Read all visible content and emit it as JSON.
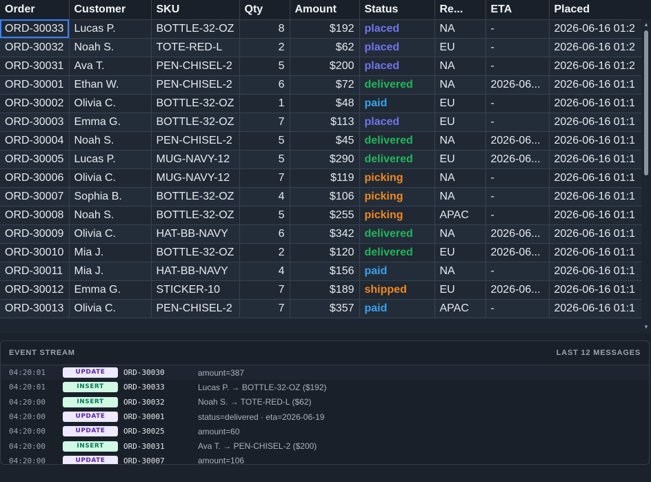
{
  "grid": {
    "columns": [
      "Order",
      "Customer",
      "SKU",
      "Qty",
      "Amount",
      "Status",
      "Re...",
      "ETA",
      "Placed"
    ],
    "rows": [
      {
        "order": "ORD-30033",
        "customer": "Lucas P.",
        "sku": "BOTTLE-32-OZ",
        "qty": "8",
        "amount": "$192",
        "status": "placed",
        "region": "NA",
        "eta": "-",
        "placed": "2026-06-16 01:2"
      },
      {
        "order": "ORD-30032",
        "customer": "Noah S.",
        "sku": "TOTE-RED-L",
        "qty": "2",
        "amount": "$62",
        "status": "placed",
        "region": "EU",
        "eta": "-",
        "placed": "2026-06-16 01:2"
      },
      {
        "order": "ORD-30031",
        "customer": "Ava T.",
        "sku": "PEN-CHISEL-2",
        "qty": "5",
        "amount": "$200",
        "status": "placed",
        "region": "NA",
        "eta": "-",
        "placed": "2026-06-16 01:2"
      },
      {
        "order": "ORD-30001",
        "customer": "Ethan W.",
        "sku": "PEN-CHISEL-2",
        "qty": "6",
        "amount": "$72",
        "status": "delivered",
        "region": "NA",
        "eta": "2026-06...",
        "placed": "2026-06-16 01:1"
      },
      {
        "order": "ORD-30002",
        "customer": "Olivia C.",
        "sku": "BOTTLE-32-OZ",
        "qty": "1",
        "amount": "$48",
        "status": "paid",
        "region": "EU",
        "eta": "-",
        "placed": "2026-06-16 01:1"
      },
      {
        "order": "ORD-30003",
        "customer": "Emma G.",
        "sku": "BOTTLE-32-OZ",
        "qty": "7",
        "amount": "$113",
        "status": "placed",
        "region": "EU",
        "eta": "-",
        "placed": "2026-06-16 01:1"
      },
      {
        "order": "ORD-30004",
        "customer": "Noah S.",
        "sku": "PEN-CHISEL-2",
        "qty": "5",
        "amount": "$45",
        "status": "delivered",
        "region": "NA",
        "eta": "2026-06...",
        "placed": "2026-06-16 01:1"
      },
      {
        "order": "ORD-30005",
        "customer": "Lucas P.",
        "sku": "MUG-NAVY-12",
        "qty": "5",
        "amount": "$290",
        "status": "delivered",
        "region": "EU",
        "eta": "2026-06...",
        "placed": "2026-06-16 01:1"
      },
      {
        "order": "ORD-30006",
        "customer": "Olivia C.",
        "sku": "MUG-NAVY-12",
        "qty": "7",
        "amount": "$119",
        "status": "picking",
        "region": "NA",
        "eta": "-",
        "placed": "2026-06-16 01:1"
      },
      {
        "order": "ORD-30007",
        "customer": "Sophia B.",
        "sku": "BOTTLE-32-OZ",
        "qty": "4",
        "amount": "$106",
        "status": "picking",
        "region": "NA",
        "eta": "-",
        "placed": "2026-06-16 01:1"
      },
      {
        "order": "ORD-30008",
        "customer": "Noah S.",
        "sku": "BOTTLE-32-OZ",
        "qty": "5",
        "amount": "$255",
        "status": "picking",
        "region": "APAC",
        "eta": "-",
        "placed": "2026-06-16 01:1"
      },
      {
        "order": "ORD-30009",
        "customer": "Olivia C.",
        "sku": "HAT-BB-NAVY",
        "qty": "6",
        "amount": "$342",
        "status": "delivered",
        "region": "NA",
        "eta": "2026-06...",
        "placed": "2026-06-16 01:1"
      },
      {
        "order": "ORD-30010",
        "customer": "Mia J.",
        "sku": "BOTTLE-32-OZ",
        "qty": "2",
        "amount": "$120",
        "status": "delivered",
        "region": "EU",
        "eta": "2026-06...",
        "placed": "2026-06-16 01:1"
      },
      {
        "order": "ORD-30011",
        "customer": "Mia J.",
        "sku": "HAT-BB-NAVY",
        "qty": "4",
        "amount": "$156",
        "status": "paid",
        "region": "NA",
        "eta": "-",
        "placed": "2026-06-16 01:1"
      },
      {
        "order": "ORD-30012",
        "customer": "Emma G.",
        "sku": "STICKER-10",
        "qty": "7",
        "amount": "$189",
        "status": "shipped",
        "region": "EU",
        "eta": "2026-06...",
        "placed": "2026-06-16 01:1"
      },
      {
        "order": "ORD-30013",
        "customer": "Olivia C.",
        "sku": "PEN-CHISEL-2",
        "qty": "7",
        "amount": "$357",
        "status": "paid",
        "region": "APAC",
        "eta": "-",
        "placed": "2026-06-16 01:1"
      }
    ]
  },
  "events": {
    "title": "EVENT STREAM",
    "summary": "LAST 12 MESSAGES",
    "items": [
      {
        "time": "04:20:01",
        "type": "UPDATE",
        "order": "ORD-30030",
        "msg": "amount=387"
      },
      {
        "time": "04:20:01",
        "type": "INSERT",
        "order": "ORD-30033",
        "msg": "Lucas P. → BOTTLE-32-OZ ($192)"
      },
      {
        "time": "04:20:00",
        "type": "INSERT",
        "order": "ORD-30032",
        "msg": "Noah S. → TOTE-RED-L ($62)"
      },
      {
        "time": "04:20:00",
        "type": "UPDATE",
        "order": "ORD-30001",
        "msg": "status=delivered · eta=2026-06-19"
      },
      {
        "time": "04:20:00",
        "type": "UPDATE",
        "order": "ORD-30025",
        "msg": "amount=60"
      },
      {
        "time": "04:20:00",
        "type": "INSERT",
        "order": "ORD-30031",
        "msg": "Ava T. → PEN-CHISEL-2 ($200)"
      },
      {
        "time": "04:20:00",
        "type": "UPDATE",
        "order": "ORD-30007",
        "msg": "amount=106"
      }
    ]
  },
  "colors": {
    "placed": "#6f74ee",
    "delivered": "#22b55b",
    "paid": "#38a2f0",
    "picking": "#f08a1c",
    "shipped": "#f08a1c"
  }
}
